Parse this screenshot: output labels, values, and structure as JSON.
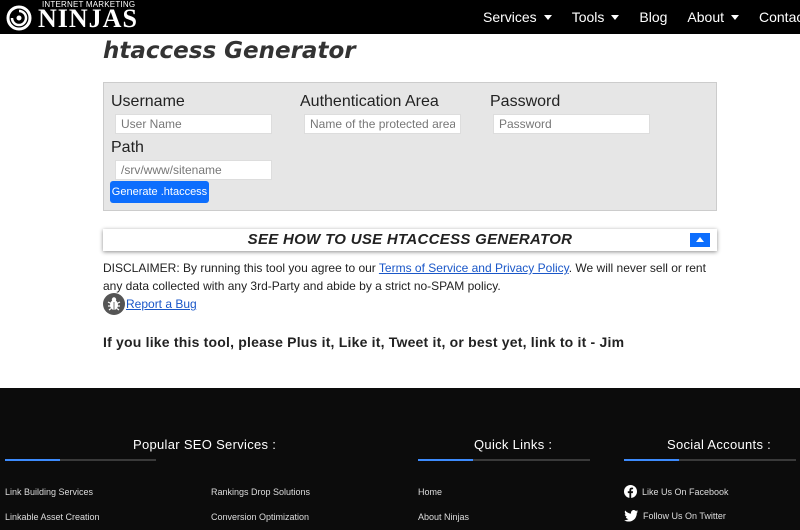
{
  "brand": {
    "top_text": "INTERNET MARKETING",
    "main_text": "NINJAS"
  },
  "nav": {
    "items": [
      {
        "label": "Services",
        "dropdown": true
      },
      {
        "label": "Tools",
        "dropdown": true
      },
      {
        "label": "Blog",
        "dropdown": false
      },
      {
        "label": "About",
        "dropdown": true
      },
      {
        "label": "Contact",
        "dropdown": false
      }
    ]
  },
  "page": {
    "title": "htaccess Generator"
  },
  "form": {
    "username_label": "Username",
    "username_placeholder": "User Name",
    "auth_label": "Authentication Area",
    "auth_placeholder": "Name of the protected area",
    "password_label": "Password",
    "password_placeholder": "Password",
    "path_label": "Path",
    "path_placeholder": "/srv/www/sitename",
    "generate_button": "Generate .htaccess"
  },
  "howto": {
    "label": "SEE HOW TO USE HTACCESS GENERATOR"
  },
  "disclaimer": {
    "prefix": "DISCLAIMER: By running this tool you agree to our ",
    "link": "Terms of Service and Privacy Policy",
    "suffix": ". We will never sell or rent any data collected with any 3rd-Party and abide by a strict no-SPAM policy."
  },
  "report": {
    "label": "Report a Bug"
  },
  "cta": {
    "text": "If you like this tool, please Plus it, Like it, Tweet it, or best yet, link to it - Jim"
  },
  "footer": {
    "popular": {
      "heading": "Popular SEO Services :",
      "links": [
        "Link Building Services",
        "Rankings Drop Solutions",
        "Linkable Asset Creation",
        "Conversion Optimization"
      ]
    },
    "quick": {
      "heading": "Quick Links :",
      "links": [
        "Home",
        "About Ninjas"
      ]
    },
    "social": {
      "heading": "Social Accounts :",
      "links": [
        {
          "label": "Like Us On Facebook",
          "icon": "facebook-icon"
        },
        {
          "label": "Follow Us On Twitter",
          "icon": "twitter-icon"
        }
      ]
    }
  },
  "colors": {
    "nav_bg": "#000000",
    "accent": "#0d6efd",
    "link": "#1a57c8",
    "footer_bg": "#0c0c0c"
  }
}
